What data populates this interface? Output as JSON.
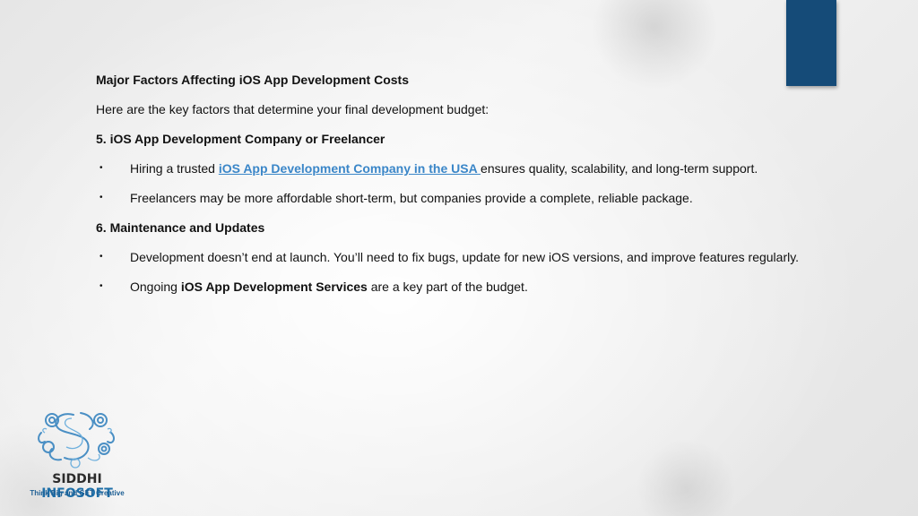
{
  "slide": {
    "heading": "Major Factors Affecting iOS App Development Costs",
    "intro": "Here are the key factors that determine your final development budget:",
    "section5": {
      "title": "5. iOS App Development Company or Freelancer",
      "bullet1": {
        "before": "Hiring a trusted ",
        "link": "iOS App Development Company in the USA ",
        "after": "ensures quality, scalability, and long-term support."
      },
      "bullet2": "Freelancers may be more affordable short-term, but companies provide a complete, reliable package."
    },
    "section6": {
      "title": "6. Maintenance and Updates",
      "bullet1": "Development doesn’t end at launch. You’ll need to fix bugs, update for new iOS versions, and improve features regularly.",
      "bullet2": {
        "before": "Ongoing ",
        "bold": "iOS App Development Services",
        "after": " are a key part of the budget."
      }
    },
    "bullet_glyph": "•"
  },
  "logo": {
    "name_part1": "SIDDHI ",
    "name_part2": "INFOSOFT",
    "tagline": "Think Big and GET Creative"
  },
  "colors": {
    "accent_tab": "#154b78",
    "link": "#3a86c8",
    "logo_blue": "#1e6fa8"
  }
}
